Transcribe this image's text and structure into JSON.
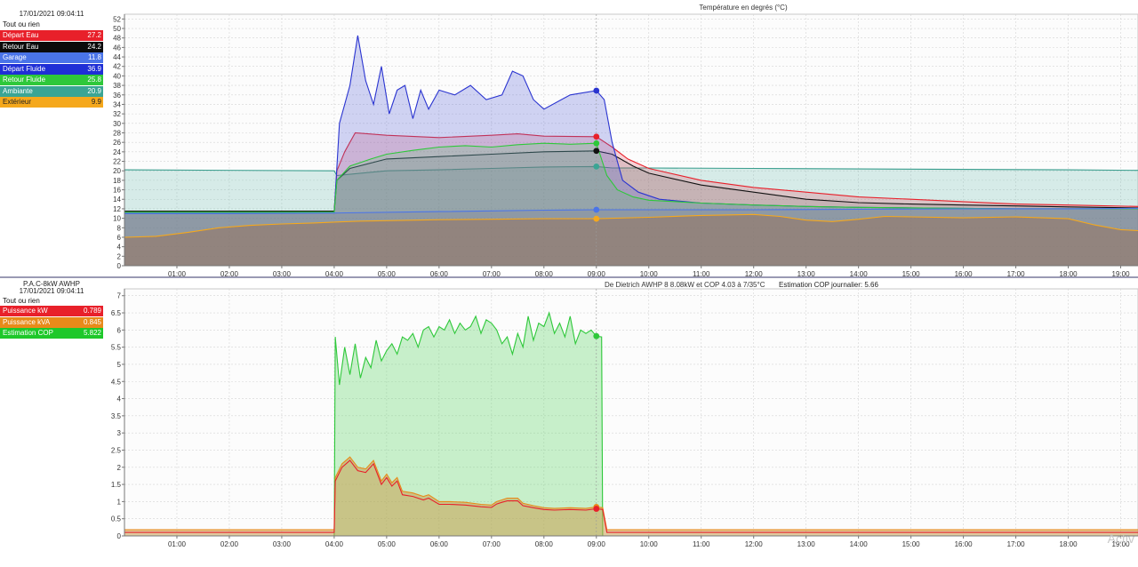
{
  "watermark": "Activ",
  "top": {
    "legend": {
      "date": "17/01/2021 09:04:11",
      "all_label": "Tout ou rien",
      "items": [
        {
          "name": "Départ Eau",
          "value": "27.2",
          "bg": "#e8202a",
          "fg": "#ffffff"
        },
        {
          "name": "Retour Eau",
          "value": "24.2",
          "bg": "#0b0b0b",
          "fg": "#ffffff"
        },
        {
          "name": "Garage",
          "value": "11.8",
          "bg": "#4a74e8",
          "fg": "#ffffff"
        },
        {
          "name": "Départ Fluide",
          "value": "36.9",
          "bg": "#1f2fd6",
          "fg": "#ffffff"
        },
        {
          "name": "Retour Fluide",
          "value": "25.8",
          "bg": "#2ec83a",
          "fg": "#ffffff"
        },
        {
          "name": "Ambiante",
          "value": "20.9",
          "bg": "#3aa594",
          "fg": "#ffffff"
        },
        {
          "name": "Extérieur",
          "value": "9.9",
          "bg": "#f5a81c",
          "fg": "#222222"
        }
      ]
    },
    "chart_data": {
      "type": "area",
      "title": "Température en degrés (°C)",
      "xlabel": "",
      "ylabel": "",
      "xlim": [
        0,
        19.33
      ],
      "ylim": [
        0,
        53
      ],
      "yticks": [
        0,
        2,
        4,
        6,
        8,
        10,
        12,
        14,
        16,
        18,
        20,
        22,
        24,
        26,
        28,
        30,
        32,
        34,
        36,
        38,
        40,
        42,
        44,
        46,
        48,
        50,
        52
      ],
      "xticks": [
        "01:00",
        "02:00",
        "03:00",
        "04:00",
        "05:00",
        "06:00",
        "07:00",
        "08:00",
        "09:00",
        "10:00",
        "11:00",
        "12:00",
        "13:00",
        "14:00",
        "15:00",
        "16:00",
        "17:00",
        "18:00",
        "19:00"
      ],
      "grid": true,
      "cursor_x": 9.0,
      "series": [
        {
          "name": "Ambiante",
          "color": "#3a9e8e",
          "fill": "rgba(84,178,162,0.22)",
          "x": [
            0,
            4.0,
            4.05,
            4.5,
            5,
            6,
            7,
            8,
            9,
            9.3,
            10,
            12,
            14,
            16,
            18,
            19.33
          ],
          "y": [
            20.2,
            20.0,
            19.0,
            19.5,
            20,
            20.2,
            20.5,
            20.8,
            20.9,
            20.6,
            20.6,
            20.5,
            20.4,
            20.3,
            20.2,
            20.1
          ]
        },
        {
          "name": "Départ Eau",
          "color": "#e8202a",
          "fill": "rgba(232,60,80,0.22)",
          "x": [
            0,
            4.0,
            4.05,
            4.2,
            4.4,
            5,
            6,
            7,
            7.5,
            8,
            9,
            9.3,
            9.6,
            10,
            11,
            12,
            13,
            14,
            15,
            16,
            17,
            18,
            19.33
          ],
          "y": [
            11.5,
            11.5,
            20,
            24,
            28,
            27.5,
            27,
            27.5,
            27.8,
            27.3,
            27.2,
            25,
            22.5,
            20.5,
            18,
            16.5,
            15.5,
            14.5,
            14,
            13.5,
            13,
            12.8,
            12.5
          ]
        },
        {
          "name": "Retour Eau",
          "color": "#111111",
          "fill": "rgba(60,60,60,0.12)",
          "x": [
            0,
            4.0,
            4.05,
            4.3,
            5,
            6,
            7,
            8,
            9,
            9.3,
            9.7,
            10,
            11,
            12,
            13,
            14,
            15,
            16,
            17,
            18,
            19.33
          ],
          "y": [
            11.5,
            11.5,
            18,
            20.5,
            22.5,
            23,
            23.5,
            24,
            24.2,
            23.5,
            21,
            19.5,
            17,
            15.5,
            14,
            13.3,
            13,
            12.8,
            12.6,
            12.4,
            12.2
          ]
        },
        {
          "name": "Départ Fluide",
          "color": "#2a34d0",
          "fill": "rgba(90,100,215,0.28)",
          "x": [
            0,
            4.0,
            4.1,
            4.3,
            4.45,
            4.6,
            4.75,
            4.9,
            5.05,
            5.2,
            5.35,
            5.5,
            5.65,
            5.8,
            6.0,
            6.3,
            6.6,
            6.9,
            7.2,
            7.4,
            7.6,
            7.8,
            8.0,
            8.5,
            9,
            9.15,
            9.3,
            9.5,
            9.8,
            10.2,
            11,
            12,
            13,
            14,
            15,
            16,
            17,
            18,
            19.33
          ],
          "y": [
            11.2,
            11.2,
            30,
            38,
            48.5,
            39,
            34,
            42,
            32,
            37,
            38,
            31,
            37,
            33,
            37,
            36,
            38,
            35,
            36,
            41,
            40,
            35,
            33,
            36,
            36.9,
            35,
            26,
            18,
            15.5,
            14,
            13.2,
            12.8,
            12.5,
            12.3,
            12.2,
            12.1,
            12.0,
            12.0,
            12.0
          ]
        },
        {
          "name": "Retour Fluide",
          "color": "#2ec83a",
          "fill": "rgba(80,200,90,0.20)",
          "x": [
            0,
            4.0,
            4.05,
            4.3,
            4.7,
            5,
            5.5,
            6,
            6.5,
            7,
            7.5,
            8,
            8.5,
            9,
            9.2,
            9.4,
            9.7,
            10,
            11,
            12,
            13,
            14,
            15,
            16,
            17,
            18,
            19.33
          ],
          "y": [
            11.3,
            11.3,
            18,
            21,
            22.5,
            23.5,
            24.3,
            25,
            25.3,
            25,
            25.5,
            25.8,
            25.6,
            25.8,
            19,
            16,
            14.5,
            13.8,
            13.2,
            12.8,
            12.5,
            12.3,
            12.2,
            12.1,
            12.0,
            12.0,
            12.0
          ]
        },
        {
          "name": "Garage",
          "color": "#4a74e8",
          "fill": "rgba(120,120,150,0.25)",
          "x": [
            0,
            2,
            4,
            6,
            8,
            9,
            10,
            12,
            14,
            16,
            18,
            19.33
          ],
          "y": [
            11.0,
            11.0,
            11.1,
            11.4,
            11.7,
            11.8,
            11.8,
            11.8,
            11.9,
            12.0,
            12.0,
            12.1
          ]
        },
        {
          "name": "Extérieur",
          "color": "#f5a81c",
          "fill": "rgba(150,115,95,0.55)",
          "x": [
            0,
            0.6,
            1.2,
            1.8,
            2.4,
            3,
            3.6,
            4,
            4.5,
            5,
            6,
            7,
            8,
            9,
            10,
            11,
            12,
            12.5,
            13,
            13.5,
            14,
            14.5,
            15,
            16,
            17,
            18,
            18.5,
            19,
            19.33
          ],
          "y": [
            6,
            6.2,
            7,
            8,
            8.5,
            8.8,
            9,
            9.2,
            9.4,
            9.5,
            9.7,
            9.8,
            9.9,
            9.9,
            10.2,
            10.6,
            10.8,
            10.4,
            9.6,
            9.3,
            9.8,
            10.4,
            10.3,
            10.1,
            10.3,
            9.9,
            8.6,
            7.6,
            7.4
          ]
        }
      ],
      "markers": [
        {
          "series": "Départ Fluide",
          "x": 9.0,
          "y": 36.9,
          "color": "#2a34d0"
        },
        {
          "series": "Départ Eau",
          "x": 9.0,
          "y": 27.2,
          "color": "#e8202a"
        },
        {
          "series": "Retour Fluide",
          "x": 9.0,
          "y": 25.8,
          "color": "#2ec83a"
        },
        {
          "series": "Retour Eau",
          "x": 9.0,
          "y": 24.2,
          "color": "#111111"
        },
        {
          "series": "Ambiante",
          "x": 9.0,
          "y": 20.9,
          "color": "#3aa594"
        },
        {
          "series": "Garage",
          "x": 9.0,
          "y": 11.8,
          "color": "#4a74e8"
        },
        {
          "series": "Extérieur",
          "x": 9.0,
          "y": 9.9,
          "color": "#f5a81c"
        }
      ]
    }
  },
  "bottom": {
    "legend": {
      "group_name": "P.A.C-8kW AWHP",
      "date": "17/01/2021 09:04:11",
      "all_label": "Tout ou rien",
      "items": [
        {
          "name": "Puissance kW",
          "value": "0.789",
          "bg": "#e8202a",
          "fg": "#ffffff"
        },
        {
          "name": "Puissance kVA",
          "value": "0.845",
          "bg": "#e88a1a",
          "fg": "#ffffff"
        },
        {
          "name": "Estimation COP",
          "value": "5.822",
          "bg": "#1ec82a",
          "fg": "#ffffff"
        }
      ]
    },
    "chart_data": {
      "type": "area",
      "title": "De Dietrich AWHP 8 8.08kW et COP 4.03 à 7/35°C",
      "subtitle": "Estimation COP journalier: 5.66",
      "xlabel": "",
      "ylabel": "",
      "xlim": [
        0,
        19.33
      ],
      "ylim": [
        0,
        7.2
      ],
      "yticks": [
        0,
        0.5,
        1,
        1.5,
        2,
        2.5,
        3,
        3.5,
        4,
        4.5,
        5,
        5.5,
        6,
        6.5,
        7
      ],
      "xticks": [
        "01:00",
        "02:00",
        "03:00",
        "04:00",
        "05:00",
        "06:00",
        "07:00",
        "08:00",
        "09:00",
        "10:00",
        "11:00",
        "12:00",
        "13:00",
        "14:00",
        "15:00",
        "16:00",
        "17:00",
        "18:00",
        "19:00"
      ],
      "grid": true,
      "cursor_x": 9.0,
      "series": [
        {
          "name": "Estimation COP",
          "color": "#2ec83a",
          "fill": "rgba(100,215,110,0.35)",
          "x": [
            0,
            4.0,
            4.02,
            4.1,
            4.2,
            4.3,
            4.4,
            4.5,
            4.6,
            4.7,
            4.8,
            4.9,
            5.0,
            5.1,
            5.2,
            5.3,
            5.4,
            5.5,
            5.6,
            5.7,
            5.8,
            5.9,
            6.0,
            6.1,
            6.2,
            6.3,
            6.4,
            6.5,
            6.6,
            6.7,
            6.8,
            6.9,
            7.0,
            7.1,
            7.2,
            7.3,
            7.4,
            7.5,
            7.6,
            7.7,
            7.8,
            7.9,
            8.0,
            8.1,
            8.2,
            8.3,
            8.4,
            8.5,
            8.6,
            8.7,
            8.8,
            8.9,
            9.0,
            9.1,
            9.12,
            9.2,
            19.33
          ],
          "y": [
            0,
            0,
            5.8,
            4.4,
            5.5,
            4.7,
            5.6,
            4.6,
            5.2,
            4.9,
            5.7,
            5.1,
            5.4,
            5.6,
            5.3,
            5.8,
            5.7,
            5.9,
            5.5,
            6.0,
            6.1,
            5.8,
            6.1,
            6.0,
            6.3,
            5.9,
            6.2,
            6.0,
            6.1,
            6.4,
            5.9,
            6.3,
            6.2,
            6.0,
            5.6,
            5.8,
            5.3,
            5.9,
            5.5,
            6.4,
            5.7,
            6.2,
            6.1,
            6.5,
            5.9,
            6.2,
            5.8,
            6.4,
            5.6,
            6.0,
            5.9,
            6.0,
            5.82,
            5.8,
            0,
            0,
            0
          ]
        },
        {
          "name": "Puissance kVA",
          "color": "#e88a1a",
          "fill": "rgba(200,160,80,0.55)",
          "x": [
            0,
            4.0,
            4.02,
            4.15,
            4.3,
            4.45,
            4.6,
            4.75,
            4.9,
            5.0,
            5.1,
            5.2,
            5.3,
            5.5,
            5.7,
            5.8,
            6.0,
            6.2,
            6.5,
            6.8,
            7.0,
            7.1,
            7.2,
            7.3,
            7.5,
            7.6,
            7.8,
            8.0,
            8.2,
            8.5,
            8.8,
            9.0,
            9.12,
            9.2,
            19.33
          ],
          "y": [
            0.18,
            0.18,
            1.7,
            2.1,
            2.3,
            2.0,
            1.95,
            2.2,
            1.6,
            1.8,
            1.55,
            1.7,
            1.3,
            1.25,
            1.15,
            1.2,
            1.0,
            1.0,
            0.98,
            0.92,
            0.9,
            1.0,
            1.05,
            1.1,
            1.1,
            0.95,
            0.88,
            0.82,
            0.8,
            0.82,
            0.8,
            0.845,
            0.82,
            0.18,
            0.18
          ]
        },
        {
          "name": "Puissance kW",
          "color": "#e8202a",
          "fill": "rgba(200,90,60,0.0)",
          "x": [
            0,
            4.0,
            4.02,
            4.15,
            4.3,
            4.45,
            4.6,
            4.75,
            4.9,
            5.0,
            5.1,
            5.2,
            5.3,
            5.5,
            5.7,
            5.8,
            6.0,
            6.2,
            6.5,
            6.8,
            7.0,
            7.1,
            7.2,
            7.3,
            7.5,
            7.6,
            7.8,
            8.0,
            8.2,
            8.5,
            8.8,
            9.0,
            9.12,
            9.2,
            19.33
          ],
          "y": [
            0.1,
            0.1,
            1.6,
            2.0,
            2.2,
            1.9,
            1.85,
            2.1,
            1.5,
            1.7,
            1.45,
            1.6,
            1.2,
            1.15,
            1.05,
            1.1,
            0.92,
            0.92,
            0.9,
            0.85,
            0.83,
            0.93,
            0.98,
            1.02,
            1.02,
            0.88,
            0.82,
            0.77,
            0.75,
            0.77,
            0.75,
            0.789,
            0.77,
            0.1,
            0.1
          ]
        }
      ],
      "markers": [
        {
          "series": "Estimation COP",
          "x": 9.0,
          "y": 5.822,
          "color": "#2ec83a"
        },
        {
          "series": "Puissance kVA",
          "x": 9.0,
          "y": 0.845,
          "color": "#e88a1a"
        },
        {
          "series": "Puissance kW",
          "x": 9.0,
          "y": 0.789,
          "color": "#e8202a"
        }
      ]
    }
  }
}
